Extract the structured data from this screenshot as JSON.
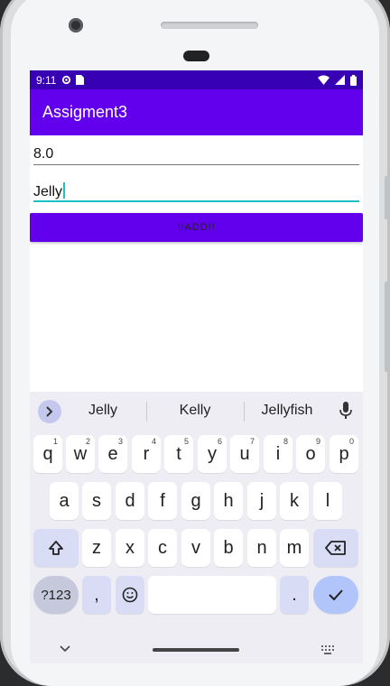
{
  "status_bar": {
    "time": "9:11"
  },
  "app_bar": {
    "title": "Assigment3"
  },
  "form": {
    "number_value": "8.0",
    "text_value": "Jelly",
    "add_button_label": "!!ADD!!"
  },
  "suggestions": [
    "Jelly",
    "Kelly",
    "Jellyfish"
  ],
  "keyboard": {
    "row1": [
      {
        "key": "q",
        "hint": "1"
      },
      {
        "key": "w",
        "hint": "2"
      },
      {
        "key": "e",
        "hint": "3"
      },
      {
        "key": "r",
        "hint": "4"
      },
      {
        "key": "t",
        "hint": "5"
      },
      {
        "key": "y",
        "hint": "6"
      },
      {
        "key": "u",
        "hint": "7"
      },
      {
        "key": "i",
        "hint": "8"
      },
      {
        "key": "o",
        "hint": "9"
      },
      {
        "key": "p",
        "hint": "0"
      }
    ],
    "row2": [
      "a",
      "s",
      "d",
      "f",
      "g",
      "h",
      "j",
      "k",
      "l"
    ],
    "row3": [
      "z",
      "x",
      "c",
      "v",
      "b",
      "n",
      "m"
    ],
    "symbols_label": "?123",
    "comma_label": ",",
    "period_label": "."
  },
  "colors": {
    "status_bar": "#3700b3",
    "primary": "#6200ee",
    "focus_underline": "#1bc1c6",
    "keyboard_bg": "#eeedf3"
  },
  "icons": [
    "gear-icon",
    "sim-icon",
    "wifi-icon",
    "signal-icon",
    "battery-icon",
    "chevron-right-icon",
    "mic-icon",
    "shift-icon",
    "backspace-icon",
    "emoji-icon",
    "check-icon",
    "chevron-down-icon",
    "keyboard-icon"
  ]
}
